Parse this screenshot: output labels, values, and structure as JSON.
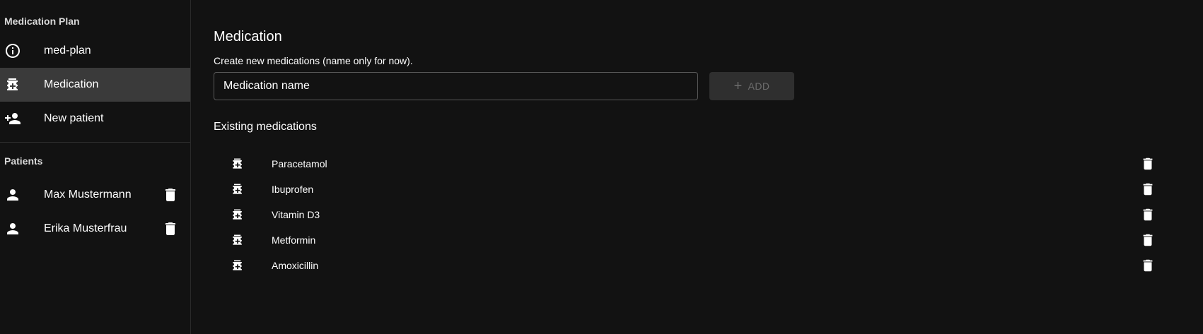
{
  "sidebar": {
    "app_title": "Medication Plan",
    "nav": [
      {
        "label": "med-plan",
        "icon": "info-icon",
        "selected": false
      },
      {
        "label": "Medication",
        "icon": "medication-icon",
        "selected": true
      },
      {
        "label": "New patient",
        "icon": "person-add-icon",
        "selected": false
      }
    ],
    "patients_heading": "Patients",
    "patients": [
      {
        "name": "Max Mustermann",
        "icon": "person-icon",
        "delete_icon": "trash-icon"
      },
      {
        "name": "Erika Musterfrau",
        "icon": "person-icon",
        "delete_icon": "trash-icon"
      }
    ]
  },
  "main": {
    "title": "Medication",
    "subtitle": "Create new medications (name only for now).",
    "input": {
      "placeholder": "Medication name",
      "value": ""
    },
    "add_button": {
      "label": "ADD",
      "icon": "plus-icon",
      "disabled": true
    },
    "existing_heading": "Existing medications",
    "medications": [
      {
        "name": "Paracetamol"
      },
      {
        "name": "Ibuprofen"
      },
      {
        "name": "Vitamin D3"
      },
      {
        "name": "Metformin"
      },
      {
        "name": "Amoxicillin"
      }
    ]
  },
  "colors": {
    "background": "#121212",
    "selected_item": "#3a3a3a",
    "disabled_button": "#2f2f2f",
    "disabled_text": "#6c6c6c",
    "text": "#ffffff"
  }
}
